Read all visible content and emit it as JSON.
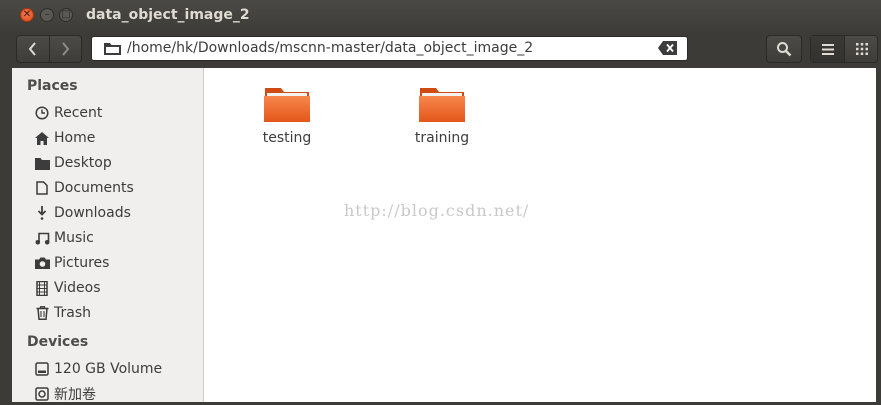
{
  "window": {
    "title": "data_object_image_2"
  },
  "toolbar": {
    "path": "/home/hk/Downloads/mscnn-master/data_object_image_2",
    "back_label": "‹",
    "forward_label": "›"
  },
  "sidebar": {
    "places_header": "Places",
    "places": [
      {
        "label": "Recent",
        "icon": "clock-icon"
      },
      {
        "label": "Home",
        "icon": "home-icon"
      },
      {
        "label": "Desktop",
        "icon": "desktop-folder-icon"
      },
      {
        "label": "Documents",
        "icon": "document-icon"
      },
      {
        "label": "Downloads",
        "icon": "download-icon"
      },
      {
        "label": "Music",
        "icon": "music-icon"
      },
      {
        "label": "Pictures",
        "icon": "camera-icon"
      },
      {
        "label": "Videos",
        "icon": "film-icon"
      },
      {
        "label": "Trash",
        "icon": "trash-icon"
      }
    ],
    "devices_header": "Devices",
    "devices": [
      {
        "label": "120 GB Volume",
        "icon": "drive-icon"
      },
      {
        "label": "新加卷",
        "icon": "drive-icon"
      }
    ]
  },
  "content": {
    "items": [
      {
        "label": "testing",
        "icon": "folder-icon"
      },
      {
        "label": "training",
        "icon": "folder-icon"
      }
    ],
    "watermark": "http://blog.csdn.net/"
  },
  "colors": {
    "close_button": "#dd4814",
    "folder_orange": "#f26522",
    "titlebar": "#3c3b37"
  }
}
